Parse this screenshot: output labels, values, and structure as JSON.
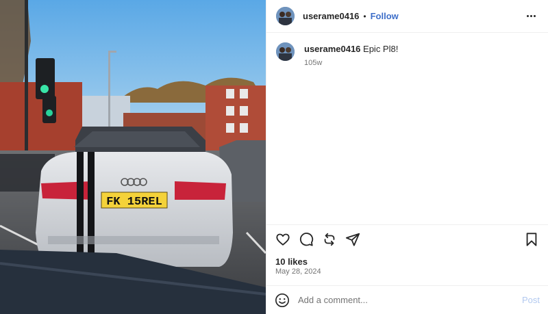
{
  "post": {
    "username": "userame0416",
    "separator": "•",
    "follow_label": "Follow",
    "caption_user": "userame0416",
    "caption_text": "Epic Pl8!",
    "caption_age": "105w",
    "likes": "10 likes",
    "date": "May 28, 2024",
    "comment_placeholder": "Add a comment...",
    "post_label": "Post"
  },
  "photo": {
    "plate": "FK 15REL"
  },
  "icons": {
    "more": "more-options-icon",
    "like": "heart-icon",
    "comment": "comment-bubble-icon",
    "repost": "repost-icon",
    "share": "send-icon",
    "save": "bookmark-icon",
    "emoji": "smiley-icon"
  },
  "colors": {
    "accent": "#3d6ec9",
    "post_disabled": "#b2c9f0",
    "muted": "#737373"
  }
}
